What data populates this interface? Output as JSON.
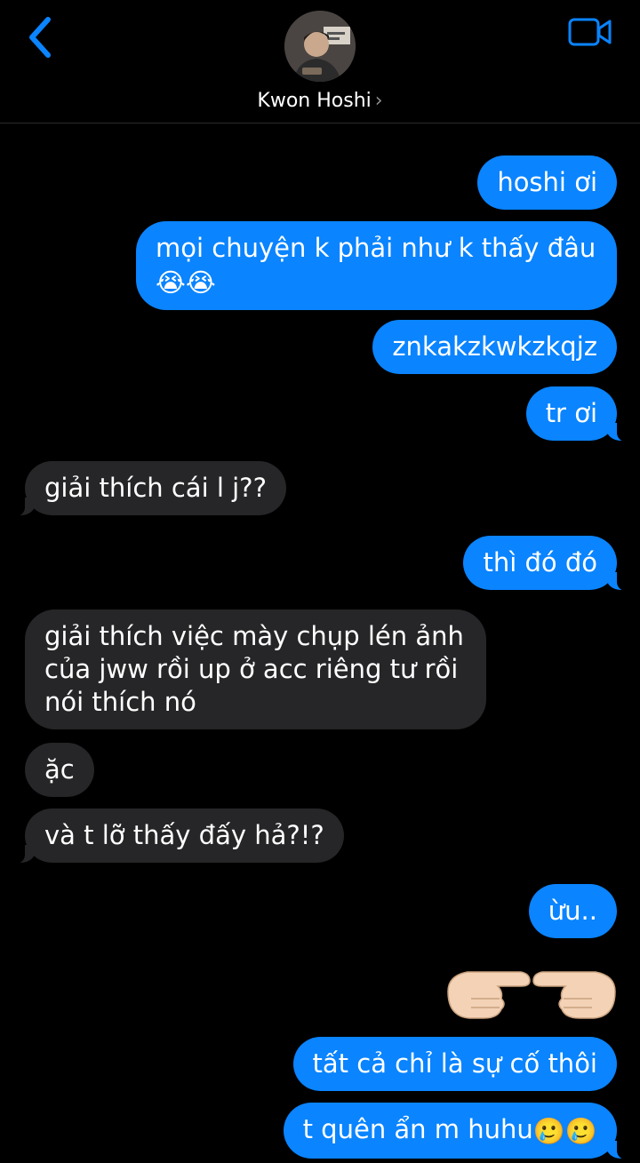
{
  "header": {
    "contact_name": "Kwon Hoshi",
    "back_icon": "chevron-left-icon",
    "video_icon": "video-camera-icon",
    "accent": "#0a84ff"
  },
  "messages": [
    {
      "from": "me",
      "text": "hoshi ơi"
    },
    {
      "from": "me",
      "text": "mọi chuyện k phải như k thấy đâu",
      "emoji": "😭😭"
    },
    {
      "from": "me",
      "text": "znkakzkwkzkqjz"
    },
    {
      "from": "me",
      "text": "tr ơi"
    },
    {
      "from": "them",
      "text": "giải thích cái l j??"
    },
    {
      "from": "me",
      "text": "thì đó đó"
    },
    {
      "from": "them",
      "text": "giải thích việc mày chụp lén ảnh của jww rồi up ở acc riêng tư rồi nói thích nó"
    },
    {
      "from": "them",
      "text": "ặc"
    },
    {
      "from": "them",
      "text": "và t lỡ thấy đấy hả?!?"
    },
    {
      "from": "me",
      "text": "ừu.."
    },
    {
      "from": "me",
      "text": "👉👈",
      "type": "emoji-only"
    },
    {
      "from": "me",
      "text": "tất cả chỉ là sự cố thôi"
    },
    {
      "from": "me",
      "text": "t quên ẩn m huhu",
      "emoji": "🥲🥲"
    }
  ],
  "colors": {
    "outgoing_bubble": "#0a84ff",
    "incoming_bubble": "#262628",
    "background": "#000000"
  }
}
